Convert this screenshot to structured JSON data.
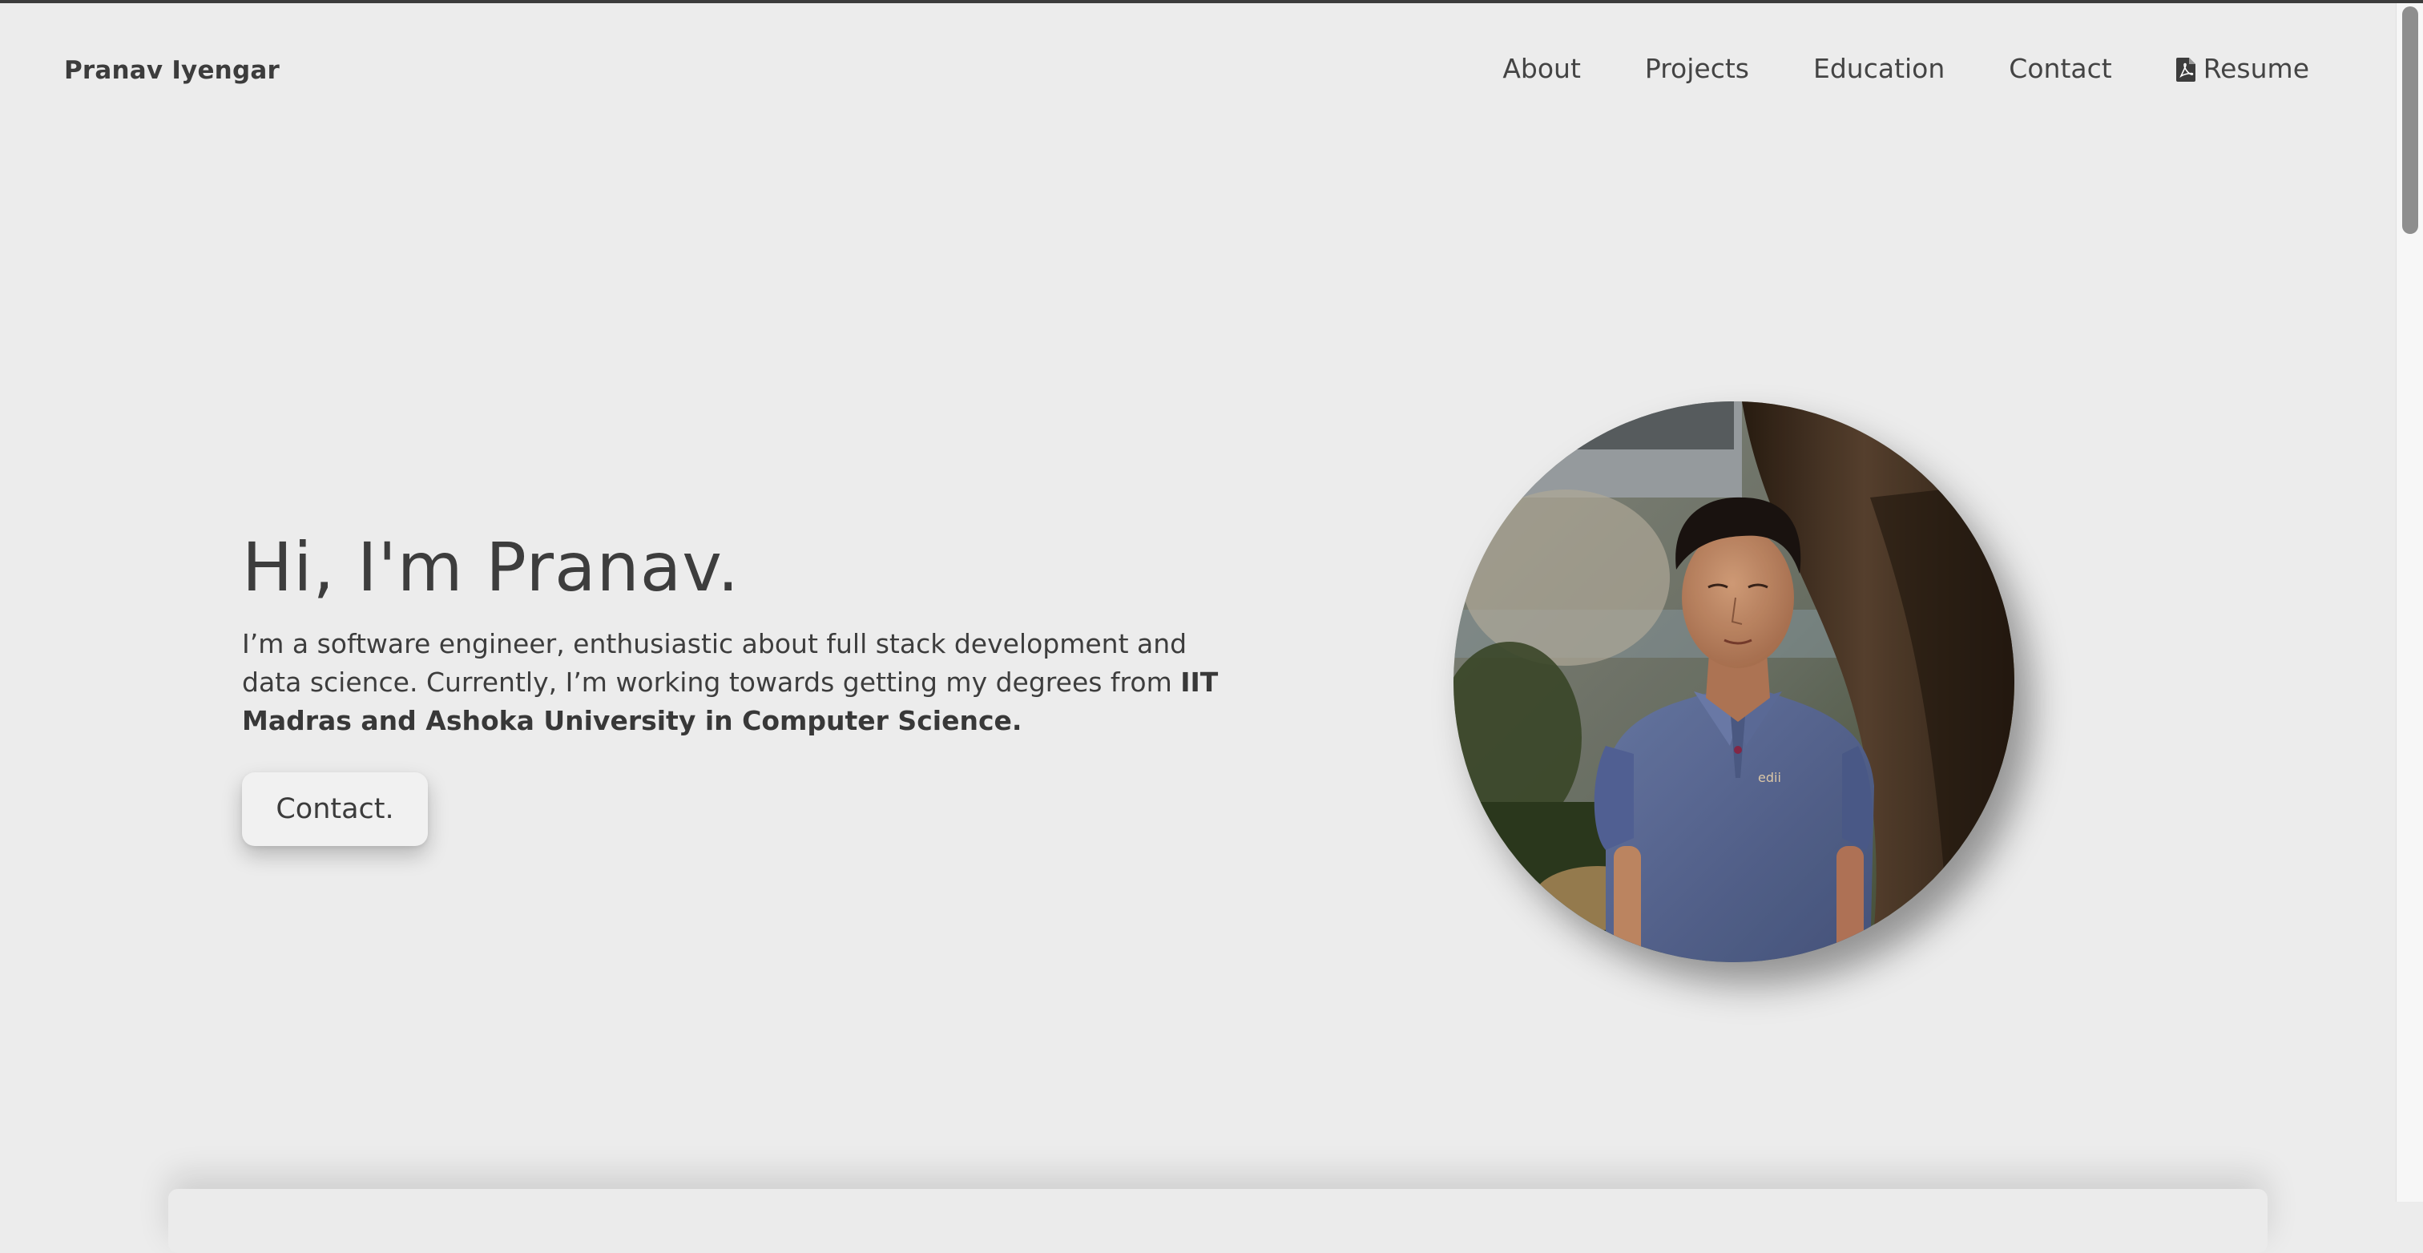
{
  "brand": {
    "name": "Pranav Iyengar"
  },
  "nav": {
    "items": [
      {
        "label": "About"
      },
      {
        "label": "Projects"
      },
      {
        "label": "Education"
      },
      {
        "label": "Contact"
      }
    ],
    "resume": {
      "label": "Resume",
      "icon": "file-pdf-icon"
    }
  },
  "hero": {
    "title": "Hi, I'm Pranav.",
    "description_plain": "I’m a software engineer, enthusiastic about full stack development and data science. Currently, I’m working towards getting my degrees from ",
    "description_bold": "IIT Madras and Ashoka University in Computer Science.",
    "button_label": "Contact."
  },
  "colors": {
    "background": "#ececec",
    "text": "#3d3d3d",
    "shirt": "#5a6a97"
  }
}
